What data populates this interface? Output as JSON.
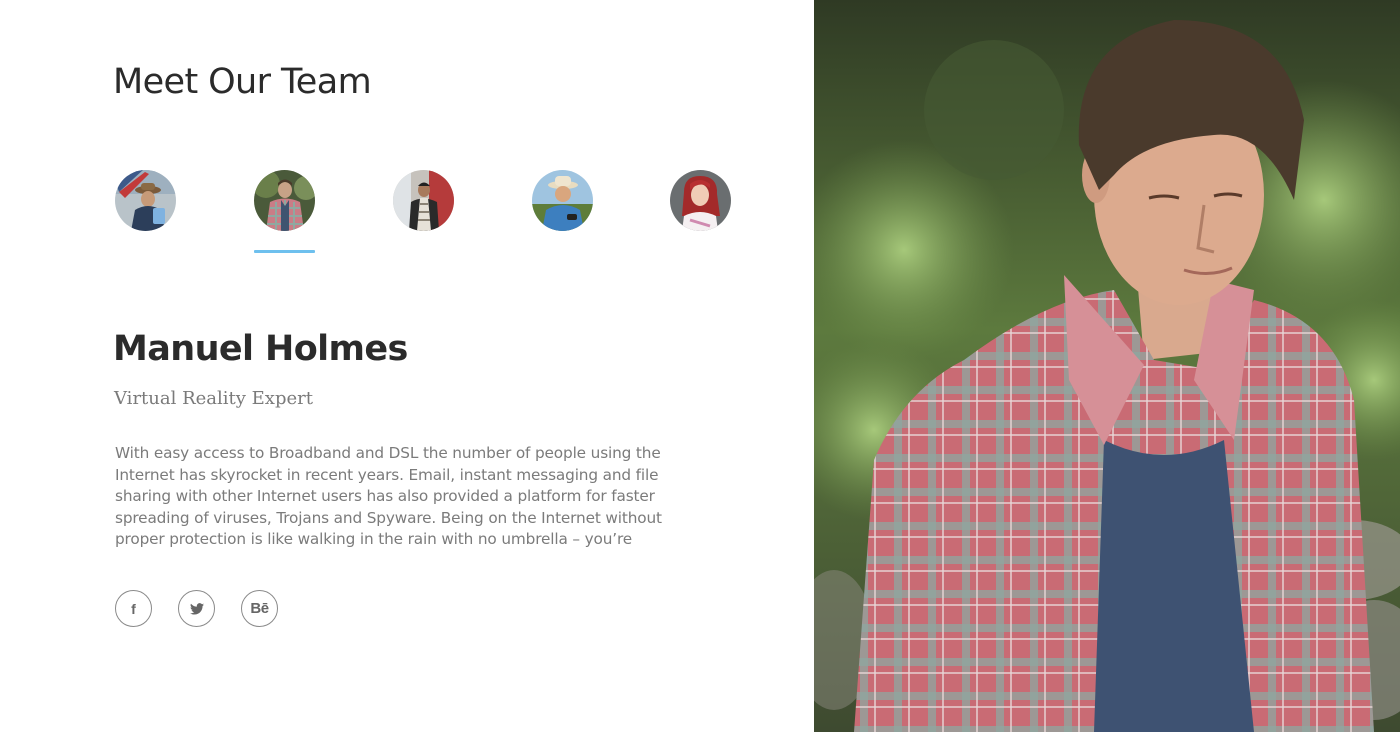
{
  "section": {
    "title": "Meet Our Team"
  },
  "team": {
    "avatars": [
      {
        "alt": "Team member 1",
        "selected": false
      },
      {
        "alt": "Team member 2",
        "selected": true
      },
      {
        "alt": "Team member 3",
        "selected": false
      },
      {
        "alt": "Team member 4",
        "selected": false
      },
      {
        "alt": "Team member 5",
        "selected": false
      }
    ],
    "accent_color": "#6ec0ee"
  },
  "member": {
    "name": "Manuel Holmes",
    "role": "Virtual Reality Expert",
    "bio": "With easy access to Broadband and DSL the number of people using the Internet has skyrocket in recent years. Email, instant messaging and file sharing with other Internet users has also provided a platform for faster spreading of viruses, Trojans and Spyware. Being on the Internet without proper protection is like walking in the rain with no umbrella – you’re",
    "photo_alt": "Manuel Holmes"
  },
  "social": {
    "facebook_label": "f",
    "twitter_icon": "twitter-icon",
    "behance_label": "Bē"
  }
}
